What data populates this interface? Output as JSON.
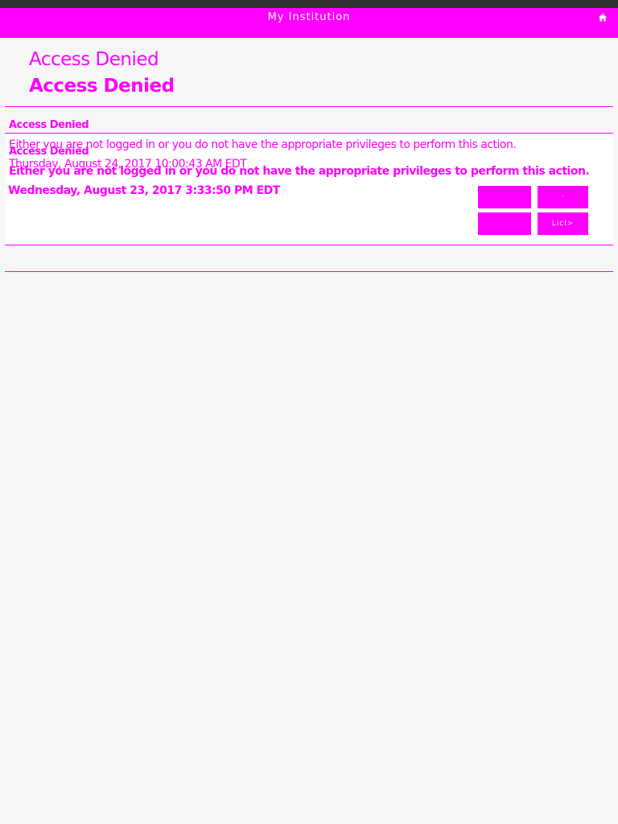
{
  "header": {
    "title": "My Institution",
    "home_icon": "home-icon",
    "accent_color": "#ff00ff"
  },
  "page": {
    "title_regular": "Access Denied",
    "title_bold": "Access Denied"
  },
  "messages": [
    {
      "title": "Access Denied",
      "text": "Either you are not logged in or you do not have the appropriate privileges to perform this action.",
      "date": "Thursday, August 24, 2017 10:00:43 AM EDT"
    },
    {
      "title": "Access Denied",
      "text": "Either you are not logged in or you do not have the appropriate privileges to perform this action.",
      "date": "Wednesday, August 23, 2017 3:33:50 PM EDT"
    }
  ],
  "actions": {
    "button_1": "",
    "button_2": "·",
    "button_3": "",
    "button_4": "Licl>"
  }
}
